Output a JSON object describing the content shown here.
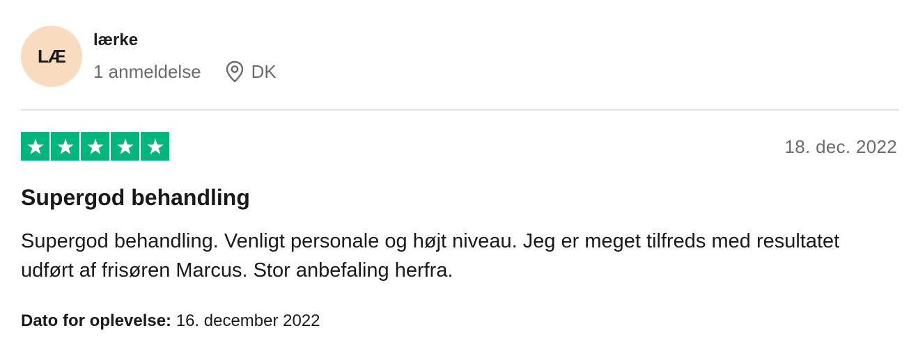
{
  "reviewer": {
    "initials": "LÆ",
    "name": "lærke",
    "review_count": "1 anmeldelse",
    "country": "DK",
    "avatar_color": "#f9dcc0"
  },
  "review": {
    "rating": 5,
    "rating_color": "#00b67a",
    "date": "18. dec. 2022",
    "title": "Supergod behandling",
    "body": "Supergod behandling. Venligt personale og højt niveau. Jeg er meget tilfreds med resultatet udført af frisøren Marcus. Stor anbefaling herfra.",
    "experience_label": "Dato for oplevelse:",
    "experience_date": "16. december 2022"
  },
  "icons": {
    "location": "location-pin-icon",
    "star": "star-icon"
  }
}
